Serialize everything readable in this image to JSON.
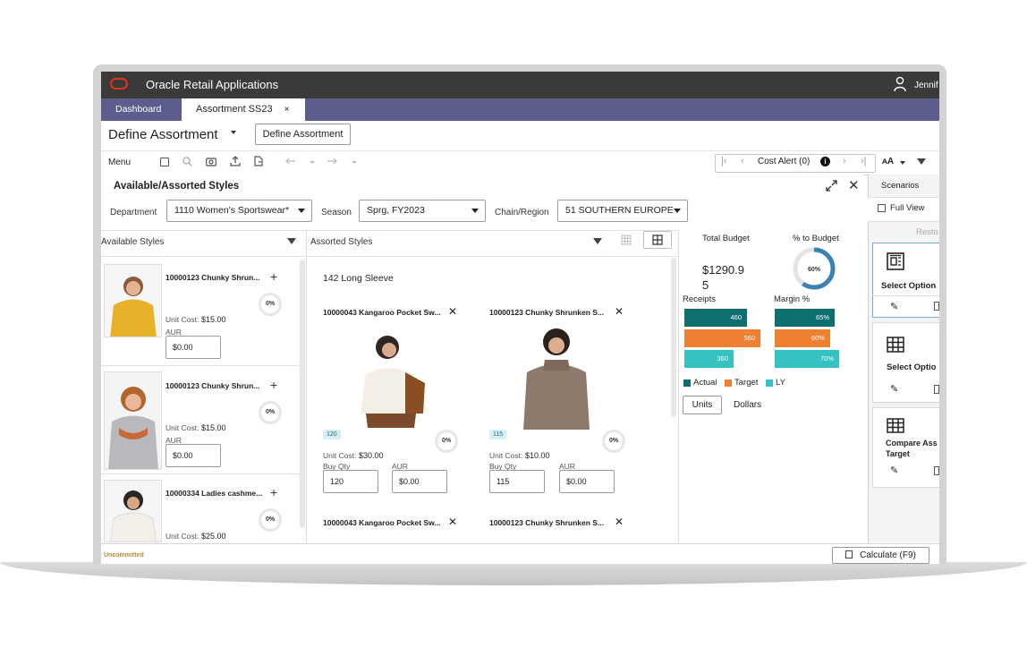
{
  "app": {
    "title": "Oracle Retail Applications",
    "user": "Jennif"
  },
  "tabs": [
    {
      "label": "Dashboard",
      "active": false
    },
    {
      "label": "Assortment SS23",
      "active": true,
      "close": "×"
    }
  ],
  "page": {
    "title": "Define Assortment",
    "define_button": "Define Assortment"
  },
  "toolbar": {
    "menu": "Menu",
    "cost_alert": "Cost Alert (0)",
    "font_size": "ᴀA"
  },
  "panel": {
    "title": "Available/Assorted Styles",
    "filters": [
      {
        "label": "Department",
        "value": "1110 Women's Sportswear*"
      },
      {
        "label": "Season",
        "value": "Sprg, FY2023"
      },
      {
        "label": "Chain/Region",
        "value": "51 SOUTHERN EUROPE"
      }
    ]
  },
  "available": {
    "label": "Available Styles",
    "items": [
      {
        "title": "10000123 Chunky Shrun...",
        "cost_label": "Unit Cost:",
        "cost": "$15.00",
        "aur_label": "AUR",
        "aur": "$0.00",
        "pct": "0%"
      },
      {
        "title": "10000123 Chunky Shrun...",
        "cost_label": "Unit Cost:",
        "cost": "$15.00",
        "aur_label": "AUR",
        "aur": "$0.00",
        "pct": "0%"
      },
      {
        "title": "10000334 Ladies cashme...",
        "cost_label": "Unit Cost:",
        "cost": "$25.00",
        "aur_label": "AUR",
        "aur": "$0.00",
        "pct": "0%"
      }
    ]
  },
  "assorted": {
    "label": "Assorted Styles",
    "group": "142 Long Sleeve",
    "items": [
      {
        "title": "10000043 Kangaroo Pocket Sw...",
        "qty_badge": "120",
        "cost_label": "Unit Cost:",
        "cost": "$30.00",
        "buy_qty_label": "Buy Qty",
        "buy_qty": "120",
        "aur_label": "AUR",
        "aur": "$0.00",
        "pct": "0%"
      },
      {
        "title": "10000123 Chunky Shrunken S...",
        "qty_badge": "115",
        "cost_label": "Unit Cost:",
        "cost": "$10.00",
        "buy_qty_label": "Buy Qty",
        "buy_qty": "115",
        "aur_label": "AUR",
        "aur": "$0.00",
        "pct": "0%"
      },
      {
        "title": "10000043 Kangaroo Pocket Sw..."
      },
      {
        "title": "10000123 Chunky Shrunken S..."
      }
    ]
  },
  "budget": {
    "total_label": "Total Budget",
    "total_value_line1": "$1290.9",
    "total_value_line2": "5",
    "pct_label": "% to Budget",
    "pct_value": "60%",
    "pct_fraction": 0.6,
    "receipts_label": "Receipts",
    "margin_label": "Margin %",
    "units_button": "Units",
    "dollars_button": "Dollars",
    "colors": {
      "actual": "#0e6f73",
      "target": "#ee8032",
      "ly": "#35c2c2"
    }
  },
  "chart_data": [
    {
      "type": "bar",
      "title": "Receipts",
      "orientation": "horizontal",
      "categories": [
        "Actual",
        "Target",
        "LY"
      ],
      "values": [
        460,
        560,
        360
      ],
      "data_labels": [
        "460",
        "560",
        "360"
      ],
      "xlim": [
        0,
        560
      ],
      "grid": false,
      "legend": "bottom"
    },
    {
      "type": "bar",
      "title": "Margin %",
      "orientation": "horizontal",
      "categories": [
        "Actual",
        "Target",
        "LY"
      ],
      "values": [
        65,
        60,
        70
      ],
      "data_labels": [
        "65%",
        "60%",
        "70%"
      ],
      "xlim": [
        0,
        70
      ],
      "grid": false,
      "legend": "bottom"
    }
  ],
  "legend": [
    {
      "name": "Actual",
      "color": "#0e6f73"
    },
    {
      "name": "Target",
      "color": "#ee8032"
    },
    {
      "name": "LY",
      "color": "#35c2c2"
    }
  ],
  "scenarios": {
    "title": "Scenarios",
    "full_view": "Full View",
    "restore": "Resto",
    "cards": [
      {
        "title": "Select Option",
        "icon": "layout-icon",
        "selected": true
      },
      {
        "title": "Select Optio",
        "icon": "grid-icon",
        "selected": false
      },
      {
        "title": "Compare Ass",
        "title2": "Target",
        "icon": "table-icon",
        "selected": false
      }
    ]
  },
  "status": {
    "uncommitted": "Uncommitted",
    "calculate": "Calculate (F9)"
  }
}
